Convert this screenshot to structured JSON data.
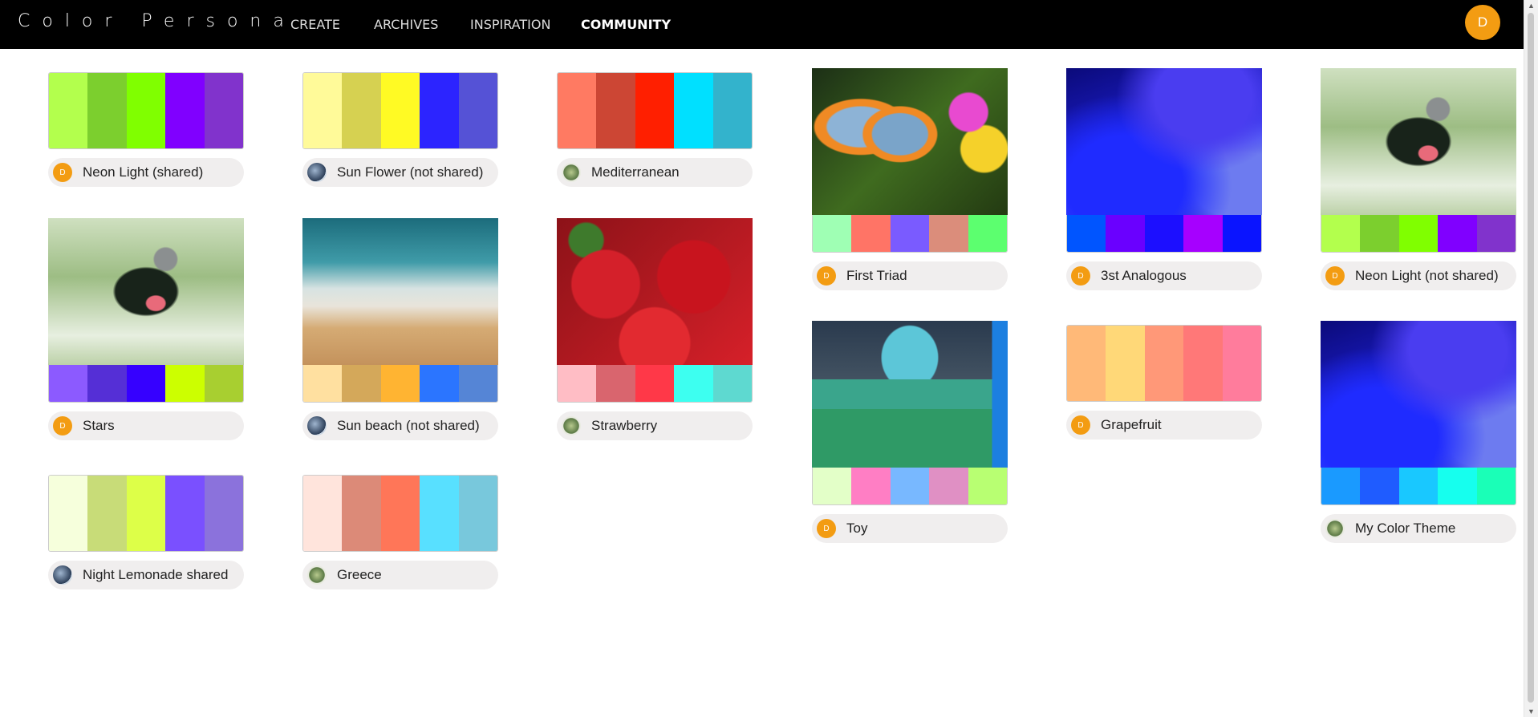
{
  "brand": "Color Persona",
  "nav": [
    {
      "label": "CREATE",
      "active": false
    },
    {
      "label": "ARCHIVES",
      "active": false
    },
    {
      "label": "INSPIRATION",
      "active": false
    },
    {
      "label": "COMMUNITY",
      "active": true
    }
  ],
  "user_avatar": "D",
  "cards": [
    {
      "name": "Neon Light (shared)",
      "avatar": "D",
      "image": null,
      "colors": [
        "#b3ff4d",
        "#7ccf2e",
        "#80ff00",
        "#8000ff",
        "#8133cc"
      ]
    },
    {
      "name": "Sun Flower (not shared)",
      "avatar": "earth",
      "image": null,
      "colors": [
        "#fffa99",
        "#d6d151",
        "#fffa24",
        "#2c24ff",
        "#5552d6"
      ]
    },
    {
      "name": "Mediterranean",
      "avatar": "plant",
      "image": null,
      "colors": [
        "#ff7a62",
        "#cc4634",
        "#ff1f00",
        "#00e0ff",
        "#33b3cc"
      ]
    },
    {
      "name": "First Triad",
      "avatar": "D",
      "image": "butterfly",
      "colors": [
        "#9fffb4",
        "#ff7466",
        "#7a5bff",
        "#db8d7b",
        "#5cff6f"
      ]
    },
    {
      "name": "3st Analogous",
      "avatar": "D",
      "image": "wave",
      "colors": [
        "#0055ff",
        "#6a00ff",
        "#1c0fff",
        "#a600ff",
        "#0a14ff"
      ]
    },
    {
      "name": "Neon Light (not shared)",
      "avatar": "D",
      "image": "parrot",
      "colors": [
        "#b3ff4d",
        "#7ccf2e",
        "#80ff00",
        "#8000ff",
        "#8133cc"
      ]
    },
    {
      "name": "Stars",
      "avatar": "D",
      "image": "parrot",
      "colors": [
        "#8c5aff",
        "#552fd6",
        "#3600ff",
        "#ccff00",
        "#a8cf30"
      ]
    },
    {
      "name": "Sun beach (not shared)",
      "avatar": "earth",
      "image": "beach",
      "colors": [
        "#ffe0a0",
        "#d4a85a",
        "#ffb432",
        "#2b75ff",
        "#5585d6"
      ]
    },
    {
      "name": "Strawberry",
      "avatar": "plant",
      "image": "strawberry",
      "colors": [
        "#ffbdc5",
        "#d9656e",
        "#ff3848",
        "#3dfff0",
        "#5ed9d0"
      ]
    },
    {
      "name": "Toy",
      "avatar": "D",
      "image": "toy",
      "colors": [
        "#e3ffc8",
        "#ff7ec4",
        "#78b8ff",
        "#e090c4",
        "#b8ff72"
      ]
    },
    {
      "name": "Grapefruit",
      "avatar": "D",
      "image": null,
      "colors": [
        "#ffb978",
        "#ffd878",
        "#ff9878",
        "#ff7878",
        "#ff7c9c"
      ]
    },
    {
      "name": "My Color Theme",
      "avatar": "plant",
      "image": "wave",
      "colors": [
        "#1a9aff",
        "#1f5cff",
        "#19c8ff",
        "#16ffee",
        "#1affb7"
      ]
    },
    {
      "name": "Night Lemonade shared",
      "avatar": "earth",
      "image": null,
      "colors": [
        "#f6ffdc",
        "#c8dc78",
        "#ddff48",
        "#7a50ff",
        "#8b72dc"
      ]
    },
    {
      "name": "Greece",
      "avatar": "plant",
      "image": null,
      "colors": [
        "#ffe4dc",
        "#dc8a78",
        "#ff7658",
        "#58e0ff",
        "#78c8dc"
      ]
    }
  ]
}
